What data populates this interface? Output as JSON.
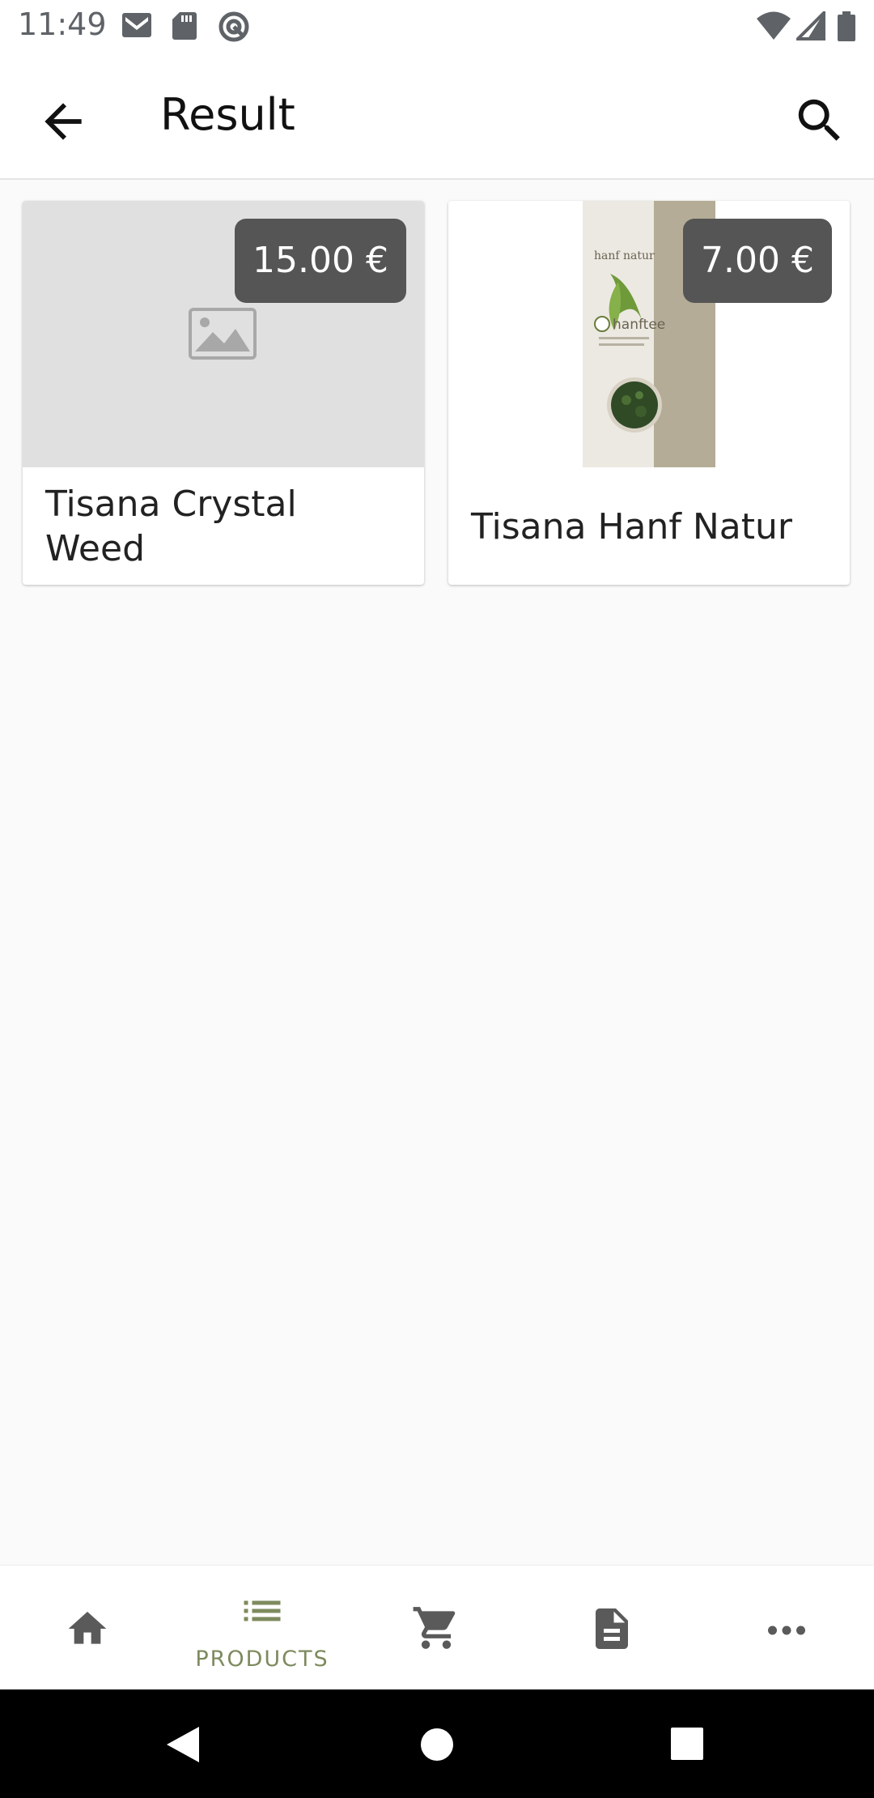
{
  "status_bar": {
    "time": "11:49",
    "left_icons": [
      "gmail-icon",
      "sd-card-icon",
      "vpn-icon"
    ],
    "right_icons": [
      "wifi-icon",
      "signal-icon",
      "battery-icon"
    ]
  },
  "app_bar": {
    "title": "Result",
    "back_icon": "arrow-back-icon",
    "search_icon": "search-icon"
  },
  "products": [
    {
      "name": "Tisana Crystal Weed",
      "price": "15.00 €",
      "image": "image-placeholder-icon"
    },
    {
      "name": "Tisana Hanf Natur",
      "price": "7.00 €",
      "image": "hanftee-product-photo"
    }
  ],
  "product_image_text": {
    "brand": "hanf natur",
    "product": "hanftee"
  },
  "bottom_nav": {
    "items": [
      {
        "icon": "home-icon",
        "label": ""
      },
      {
        "icon": "list-icon",
        "label": "PRODUCTS",
        "active": true
      },
      {
        "icon": "cart-icon",
        "label": ""
      },
      {
        "icon": "document-icon",
        "label": ""
      },
      {
        "icon": "more-icon",
        "label": ""
      }
    ],
    "active_color": "#7d8a5e"
  },
  "system_nav": [
    "back-triangle-icon",
    "home-circle-icon",
    "recents-square-icon"
  ]
}
